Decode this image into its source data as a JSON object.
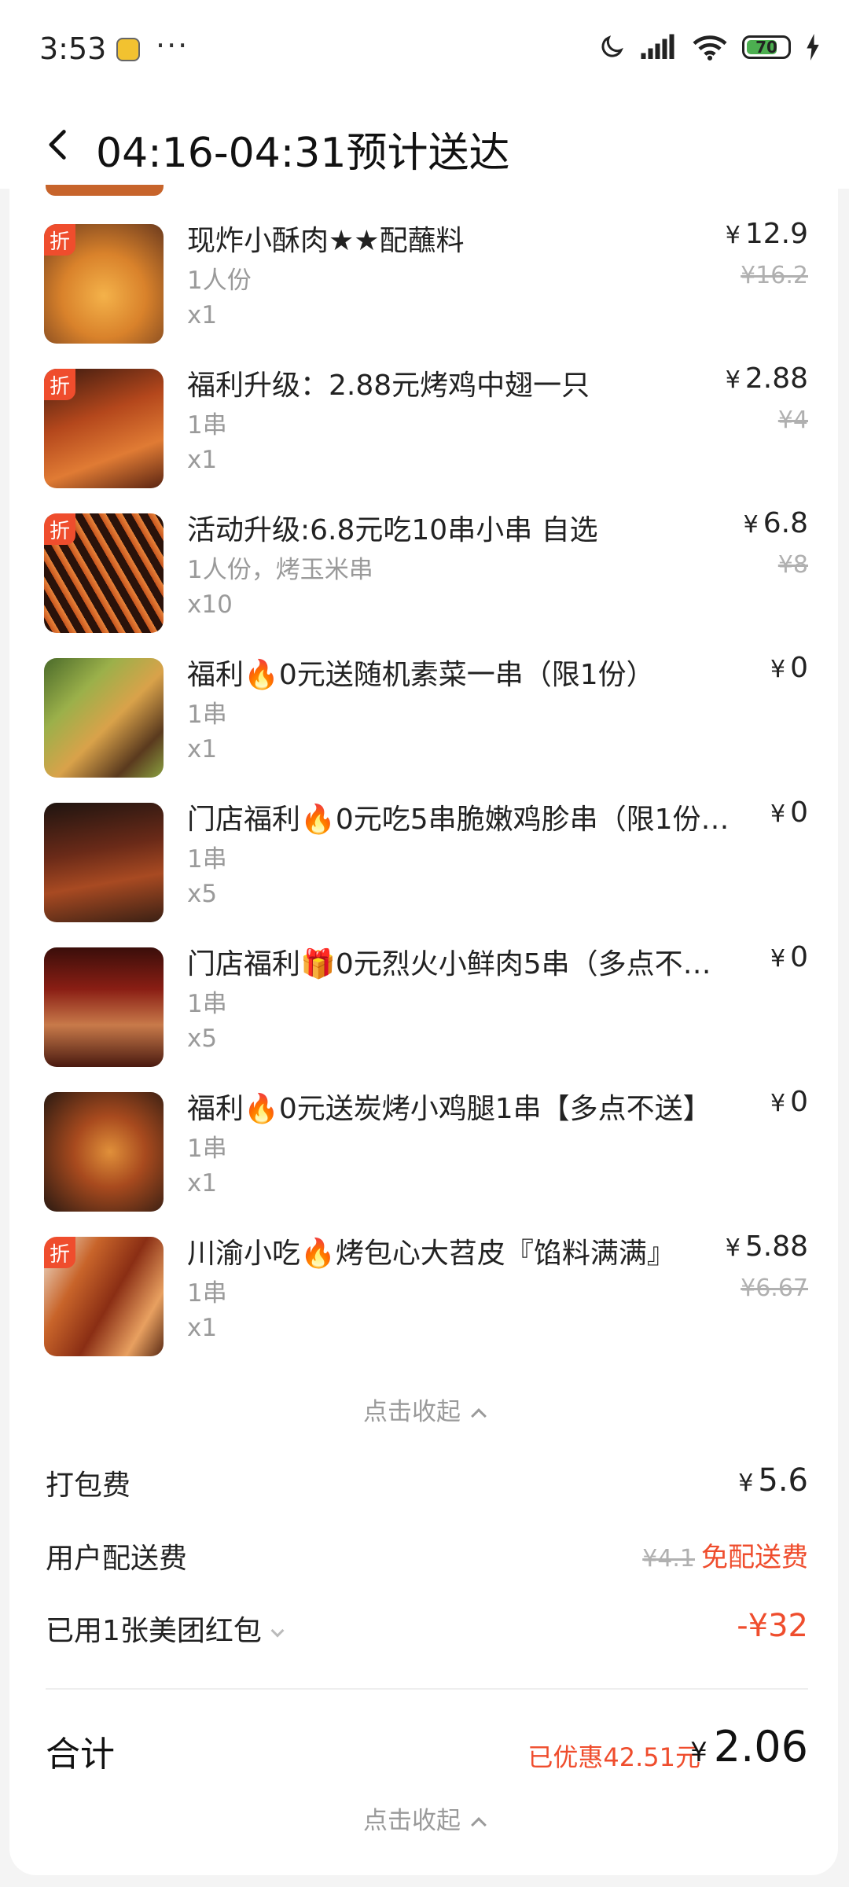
{
  "status_bar": {
    "time": "3:53",
    "more": "···",
    "battery": "70"
  },
  "header": {
    "title": "04:16-04:31预计送达"
  },
  "items": [
    {
      "name": "现炸小酥肉★★配蘸料",
      "spec": "1人份",
      "qty": "x1",
      "price": "12.9",
      "original_price": "¥16.2",
      "discount_badge": "折"
    },
    {
      "name": "福利升级：2.88元烤鸡中翅一只",
      "spec": "1串",
      "qty": "x1",
      "price": "2.88",
      "original_price": "¥4",
      "discount_badge": "折"
    },
    {
      "name": "活动升级:6.8元吃10串小串 自选",
      "spec": "1人份，烤玉米串",
      "qty": "x10",
      "price": "6.8",
      "original_price": "¥8",
      "discount_badge": "折"
    },
    {
      "name": "福利🔥0元送随机素菜一串（限1份）",
      "spec": "1串",
      "qty": "x1",
      "price": "0"
    },
    {
      "name": "门店福利🔥0元吃5串脆嫩鸡胗串（限1份…",
      "spec": "1串",
      "qty": "x5",
      "price": "0"
    },
    {
      "name": "门店福利🎁0元烈火小鲜肉5串（多点不…",
      "spec": "1串",
      "qty": "x5",
      "price": "0"
    },
    {
      "name": "福利🔥0元送炭烤小鸡腿1串【多点不送】",
      "spec": "1串",
      "qty": "x1",
      "price": "0"
    },
    {
      "name": "川渝小吃🔥烤包心大苕皮『馅料满满』",
      "spec": "1串",
      "qty": "x1",
      "price": "5.88",
      "original_price": "¥6.67",
      "discount_badge": "折"
    }
  ],
  "currency": "¥",
  "collapse_label": "点击收起",
  "fees": {
    "packing_label": "打包费",
    "packing_value": "5.6",
    "delivery_label": "用户配送费",
    "delivery_original": "¥4.1",
    "delivery_free": "免配送费",
    "coupon_label": "已用1张美团红包",
    "coupon_value": "-¥32"
  },
  "total": {
    "label": "合计",
    "saved": "已优惠42.51元",
    "value": "2.06"
  },
  "colors": {
    "accent_red": "#ef4d2d",
    "muted": "#9a9a9a"
  }
}
